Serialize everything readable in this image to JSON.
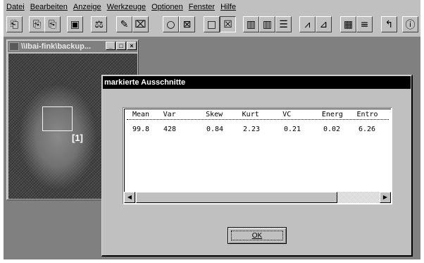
{
  "menubar": {
    "items": [
      "Datei",
      "Bearbeiten",
      "Anzeige",
      "Werkzeuge",
      "Optionen",
      "Fenster",
      "Hilfe"
    ]
  },
  "toolbar": {
    "buttons": [
      {
        "icon": "open-icon",
        "glyph": "⎗"
      },
      {
        "icon": "copy-icon",
        "glyph": "⎘"
      },
      {
        "icon": "save-icon",
        "glyph": "▣"
      },
      {
        "icon": "scale-icon",
        "glyph": "⚖"
      },
      {
        "icon": "pencil-icon",
        "glyph": "✎"
      },
      {
        "icon": "eraser-icon",
        "glyph": "⌧"
      },
      {
        "icon": "circle-icon",
        "glyph": "○"
      },
      {
        "icon": "circle-x-icon",
        "glyph": "⊠"
      },
      {
        "icon": "rectangle-icon",
        "glyph": "□"
      },
      {
        "icon": "rectangle-x-icon",
        "glyph": "☒"
      },
      {
        "icon": "columns-icon",
        "glyph": "▥"
      },
      {
        "icon": "columns-alt-icon",
        "glyph": "▥"
      },
      {
        "icon": "list-icon",
        "glyph": "☰"
      },
      {
        "icon": "profile-icon",
        "glyph": "⩘"
      },
      {
        "icon": "histogram-icon",
        "glyph": "⊿"
      },
      {
        "icon": "grid-icon",
        "glyph": "▦"
      },
      {
        "icon": "bars-icon",
        "glyph": "≡"
      },
      {
        "icon": "return-icon",
        "glyph": "↰"
      },
      {
        "icon": "info-icon",
        "glyph": "ⓘ"
      }
    ]
  },
  "image_window": {
    "title": "\\\\Ibai-fink\\backup...",
    "roi_label": "[1]"
  },
  "dialog": {
    "title": "markierte Ausschnitte",
    "columns": [
      "Mean",
      "Var",
      "Skew",
      "Kurt",
      "VC",
      "Energ",
      "Entro"
    ],
    "rows": [
      [
        "99.8",
        "428",
        "0.84",
        "2.23",
        "0.21",
        "0.02",
        "6.26"
      ]
    ],
    "ok_label": "OK"
  }
}
